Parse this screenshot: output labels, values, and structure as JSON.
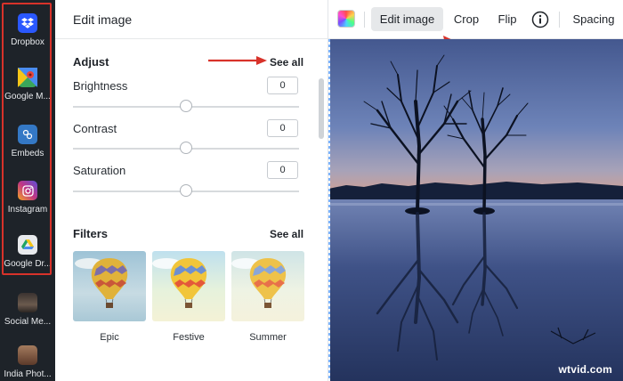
{
  "sidebar": {
    "items": [
      {
        "label": "Dropbox",
        "icon": "dropbox-icon",
        "bg": "#2a58ff"
      },
      {
        "label": "Google M...",
        "icon": "google-maps-icon",
        "bg": "#3aa65b"
      },
      {
        "label": "Embeds",
        "icon": "embeds-icon",
        "bg": "#3478c5"
      },
      {
        "label": "Instagram",
        "icon": "instagram-icon",
        "bg": "#c13584"
      },
      {
        "label": "Google Dr...",
        "icon": "google-drive-icon",
        "bg": "#e8eaed"
      },
      {
        "label": "Social Me...",
        "icon": "social-media-icon",
        "bg": "#5b4c44"
      },
      {
        "label": "India Phot...",
        "icon": "india-photos-icon",
        "bg": "#7a5b49"
      }
    ]
  },
  "panel": {
    "title": "Edit image",
    "adjust": {
      "title": "Adjust",
      "see_all": "See all",
      "controls": [
        {
          "label": "Brightness",
          "value": "0",
          "level": 0.5
        },
        {
          "label": "Contrast",
          "value": "0",
          "level": 0.5
        },
        {
          "label": "Saturation",
          "value": "0",
          "level": 0.5
        }
      ]
    },
    "filters": {
      "title": "Filters",
      "see_all": "See all",
      "items": [
        {
          "label": "Epic"
        },
        {
          "label": "Festive"
        },
        {
          "label": "Summer"
        }
      ]
    }
  },
  "toolbar": {
    "edit_image": "Edit image",
    "crop": "Crop",
    "flip": "Flip",
    "spacing": "Spacing"
  },
  "canvas": {
    "watermark": "wtvid.com"
  },
  "colors": {
    "highlight": "#d8322a",
    "rail_bg": "#1e2329",
    "active_btn": "#e6e8ea"
  }
}
